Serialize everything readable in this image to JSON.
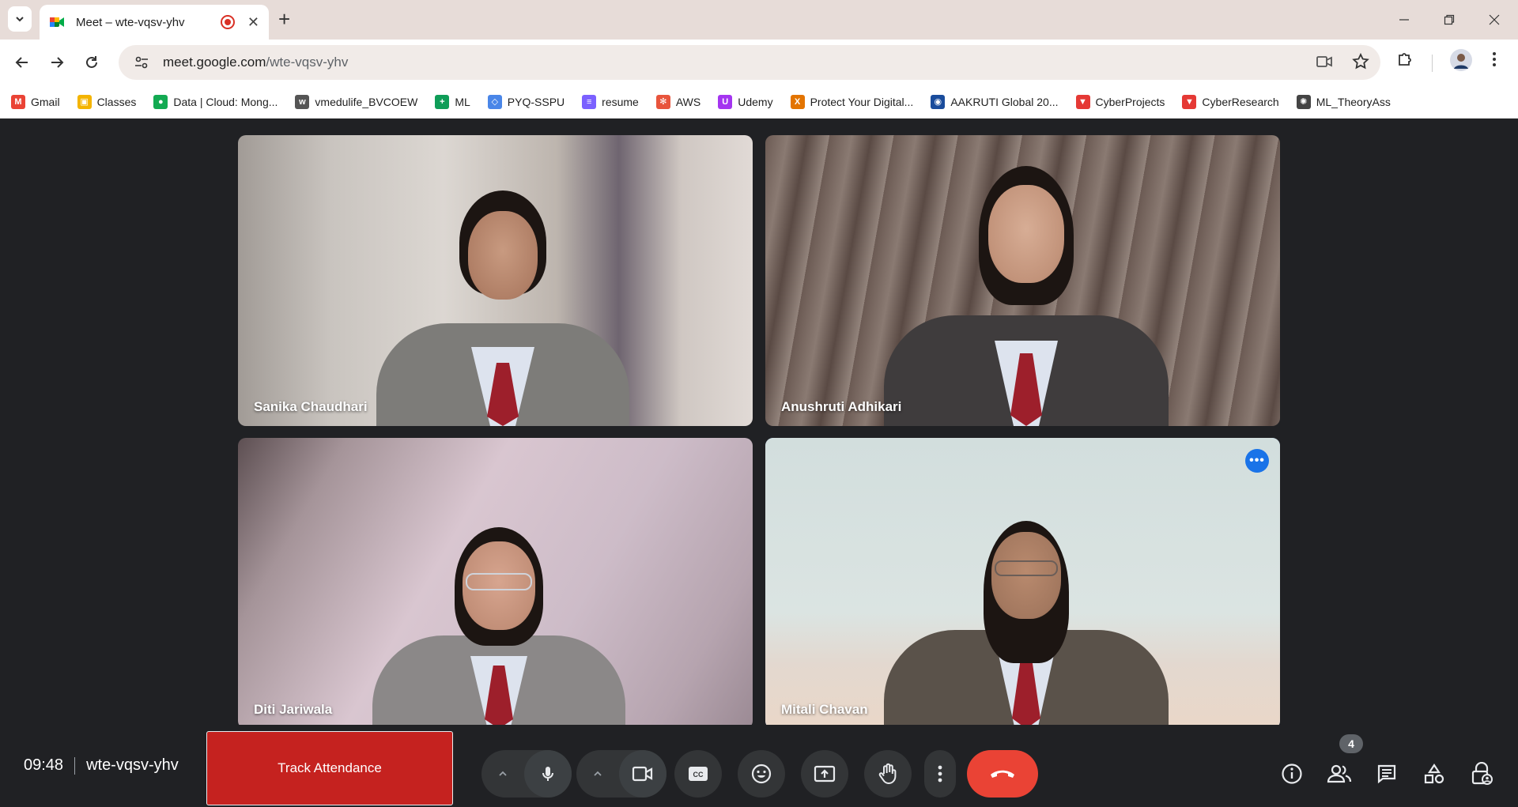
{
  "browser": {
    "tab_title": "Meet – wte-vqsv-yhv",
    "tab_close": "✕",
    "new_tab": "+",
    "url_host": "meet.google.com",
    "url_path": "/wte-vqsv-yhv"
  },
  "bookmarks": [
    {
      "label": "Gmail",
      "icon": "gmail-icon",
      "color": "#ea4335",
      "glyph": "M"
    },
    {
      "label": "Classes",
      "icon": "classes-icon",
      "color": "#f4b400",
      "glyph": "▣"
    },
    {
      "label": "Data | Cloud: Mong...",
      "icon": "mongodb-icon",
      "color": "#13aa52",
      "glyph": "●"
    },
    {
      "label": "vmedulife_BVCOEW",
      "icon": "vmedulife-icon",
      "color": "#555555",
      "glyph": "w"
    },
    {
      "label": "ML",
      "icon": "sheets-icon",
      "color": "#0f9d58",
      "glyph": "+"
    },
    {
      "label": "PYQ-SSPU",
      "icon": "pyq-icon",
      "color": "#4a86e8",
      "glyph": "◇"
    },
    {
      "label": "resume",
      "icon": "resume-icon",
      "color": "#7b61ff",
      "glyph": "≡"
    },
    {
      "label": "AWS",
      "icon": "aws-icon",
      "color": "#e8543c",
      "glyph": "✻"
    },
    {
      "label": "Udemy",
      "icon": "udemy-icon",
      "color": "#a435f0",
      "glyph": "U"
    },
    {
      "label": "Protect Your Digital...",
      "icon": "protect-icon",
      "color": "#e37400",
      "glyph": "X"
    },
    {
      "label": "AAKRUTI Global 20...",
      "icon": "globe-icon",
      "color": "#1a4c9c",
      "glyph": "◉"
    },
    {
      "label": "CyberProjects",
      "icon": "cyberprojects-icon",
      "color": "#e53935",
      "glyph": "▼"
    },
    {
      "label": "CyberResearch",
      "icon": "cyberresearch-icon",
      "color": "#e53935",
      "glyph": "▼"
    },
    {
      "label": "ML_TheoryAss",
      "icon": "chatgpt-icon",
      "color": "#444444",
      "glyph": "✺"
    }
  ],
  "participants": [
    {
      "name": "Sanika Chaudhari",
      "active": false
    },
    {
      "name": "Anushruti Adhikari",
      "active": false
    },
    {
      "name": "Diti Jariwala",
      "active": false
    },
    {
      "name": "Mitali Chavan",
      "active": true
    }
  ],
  "tile_menu_label": "•••",
  "meeting": {
    "time": "09:48",
    "code": "wte-vqsv-yhv",
    "track_attendance_label": "Track Attendance",
    "people_count": "4"
  },
  "colors": {
    "end_call": "#ea4335",
    "track_attendance": "#c5221f",
    "active_speaker": "#8ab4f8",
    "stage_bg": "#202124"
  }
}
